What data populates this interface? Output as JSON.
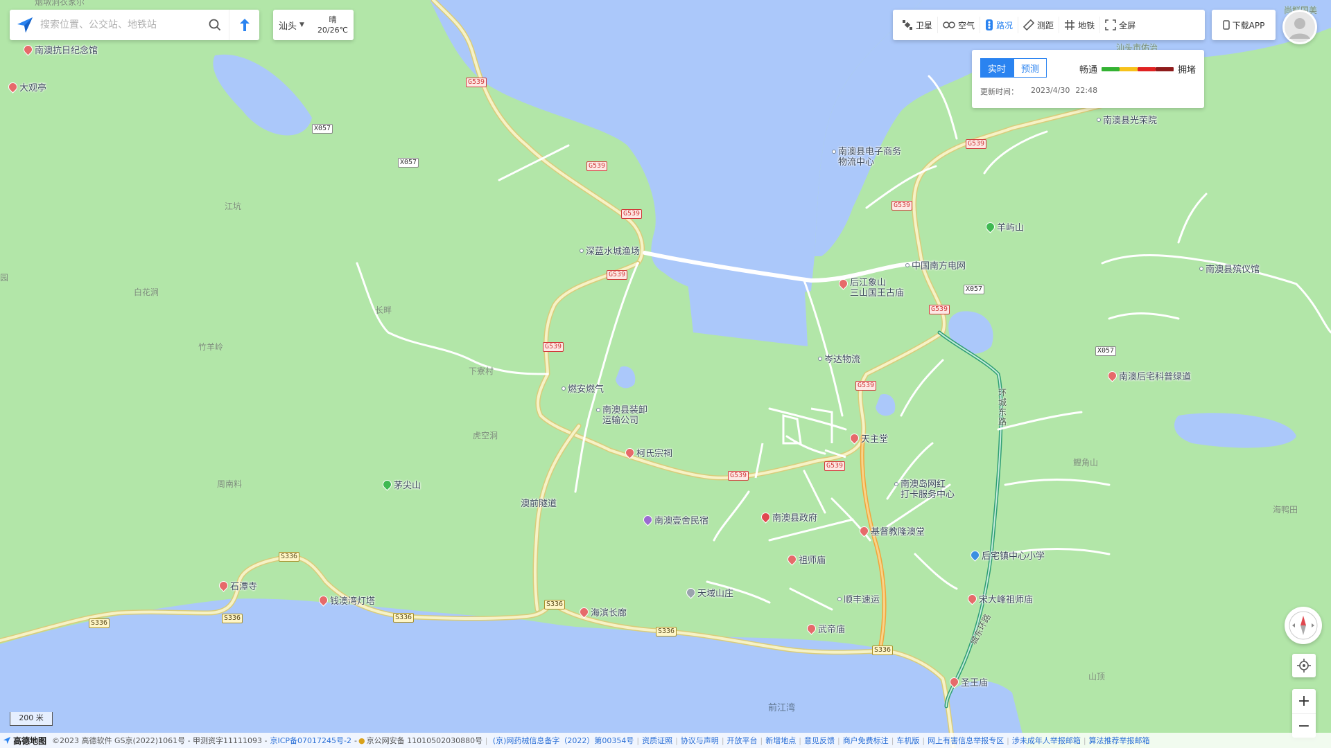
{
  "search": {
    "placeholder": "搜索位置、公交站、地铁站"
  },
  "city": {
    "name": "汕头",
    "weather": "晴",
    "temp": "20/26℃"
  },
  "toolbar": {
    "items": [
      {
        "label": "卫星",
        "icon": "satellite-icon",
        "active": false
      },
      {
        "label": "空气",
        "icon": "air-icon",
        "active": false
      },
      {
        "label": "路况",
        "icon": "traffic-icon",
        "active": true
      },
      {
        "label": "测距",
        "icon": "ruler-icon",
        "active": false
      },
      {
        "label": "地铁",
        "icon": "subway-icon",
        "active": false
      },
      {
        "label": "全屏",
        "icon": "fullscreen-icon",
        "active": false
      }
    ],
    "download": "下载APP"
  },
  "traffic": {
    "tab_realtime": "实时",
    "tab_forecast": "预测",
    "smooth": "畅通",
    "congested": "拥堵",
    "update_label": "更新时间：",
    "update_date": "2023/4/30",
    "update_time": "22:48",
    "colors": [
      "#34b233",
      "#f7c21b",
      "#e02222",
      "#8e1b1b"
    ]
  },
  "pois": {
    "nanao_kangri": "南澳抗日纪念馆",
    "daguanting": "大观亭",
    "shenlan": "深蓝水城渔场",
    "houjiang": "后江象山\n三山国王古庙",
    "nanfang_grid": "中国南方电网",
    "guangrong": "南澳县光荣院",
    "dianzi": "南澳县电子商务\n物流中心",
    "yangyushan": "羊屿山",
    "binyiguan": "南澳县殡仪馆",
    "cenda": "岑达物流",
    "ranqi": "燃安燃气",
    "zhuangxie": "南澳县装卸\n运输公司",
    "keshi": "柯氏宗祠",
    "tianzhutang": "天主堂",
    "hongda": "南澳岛网红\n打卡服务中心",
    "houzhai_kepu": "南澳后宅科普绿道",
    "maojianshan": "茅尖山",
    "minsu": "南澳壹舍民宿",
    "zhengfu": "南澳县政府",
    "jidujiao": "基督教隆澳堂",
    "zushimiao": "祖师庙",
    "xiaoxue": "后宅镇中心小学",
    "shitansi": "石潭寺",
    "dengta": "钱澳湾灯塔",
    "haibin": "海滨长廊",
    "tianyu": "天域山庄",
    "shunfeng": "顺丰速运",
    "songdafeng": "宋大峰祖师庙",
    "wudimiao": "武帝庙",
    "shengwangmiao": "圣王庙"
  },
  "places": {
    "jiangkeng": "江坑",
    "baihuajian": "白花涧",
    "zhuyangling": "竹羊岭",
    "changzhi": "长畔",
    "xialiaocun": "下寮村",
    "huqiaodong": "虎空洞",
    "zhounanliao": "周南料",
    "aoqiansuidao": "澳前隧道",
    "lijiaoshan": "鲤角山",
    "haiganggu": "海鸭田",
    "shanding": "山顶",
    "qianjiangwan": "前江湾",
    "shantou_top": "汕头市佑治",
    "left_edge": "园",
    "top_left": "烟墩洞衣家尔",
    "top_right": "尚鲜国美"
  },
  "roads": {
    "g539": "G539",
    "s336": "S336",
    "x057": "X057",
    "huancheng": "环城东路",
    "chengxi": "城东环路"
  },
  "scale": "200 米",
  "footer": {
    "brand": "高德地图",
    "copyright": "©2023 高德软件 GS京(2022)1061号 - 甲测资字11111093 -",
    "icp": "京ICP备07017245号-2",
    "police": "京公网安备 11010502030880号",
    "links": [
      "(京)网药械信息备字（2022）第00354号",
      "资质证照",
      "协议与声明",
      "开放平台",
      "新增地点",
      "意见反馈",
      "商户免费标注",
      "车机版",
      "网上有害信息举报专区",
      "涉未成年人举报邮箱",
      "算法推荐举报邮箱"
    ]
  }
}
